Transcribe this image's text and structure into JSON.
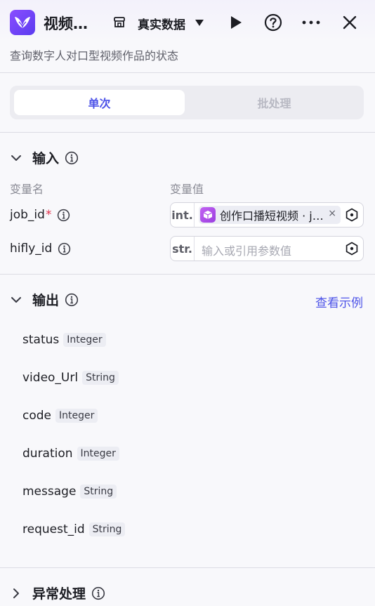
{
  "header": {
    "title": "视频…",
    "data_mode": "真实数据",
    "icons": [
      "app-logo-icon",
      "store-icon",
      "caret-down-icon",
      "play-icon",
      "help-icon",
      "more-icon",
      "close-icon"
    ]
  },
  "subtitle": "查询数字人对口型视频作品的状态",
  "tabs": {
    "single": "单次",
    "batch": "批处理"
  },
  "input_section": {
    "title": "输入",
    "col_name": "变量名",
    "col_value": "变量值",
    "rows": [
      {
        "name": "job_id",
        "required": "*",
        "type": "int.",
        "ref_text": "创作口播短视频 · j…",
        "ref_close": "×"
      },
      {
        "name": "hifly_id",
        "type": "str.",
        "placeholder": "输入或引用参数值"
      }
    ]
  },
  "output_section": {
    "title": "输出",
    "example_link": "查看示例",
    "rows": [
      {
        "name": "status",
        "type": "Integer"
      },
      {
        "name": "video_Url",
        "type": "String"
      },
      {
        "name": "code",
        "type": "Integer"
      },
      {
        "name": "duration",
        "type": "Integer"
      },
      {
        "name": "message",
        "type": "String"
      },
      {
        "name": "request_id",
        "type": "String"
      }
    ]
  },
  "error_section": {
    "title": "异常处理"
  },
  "colors": {
    "accent": "#4d53e8",
    "required": "#e0304a",
    "logo": "#6b45f5"
  }
}
